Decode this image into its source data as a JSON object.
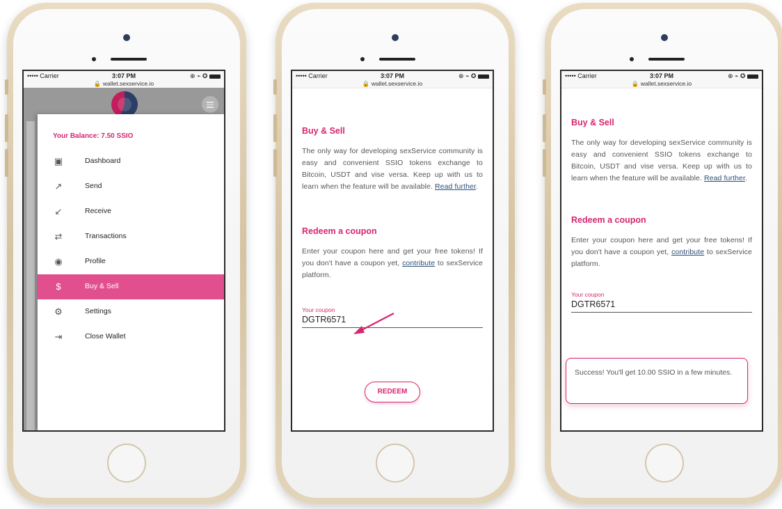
{
  "status": {
    "carrier": "••••• Carrier",
    "time": "3:07 PM",
    "url": "wallet.sexservice.io",
    "right_icons": "⊕ ⌁ ✪"
  },
  "menu": {
    "balance": "Your Balance: 7.50 SSIO",
    "items": [
      {
        "label": "Dashboard",
        "icon": "wallet-icon"
      },
      {
        "label": "Send",
        "icon": "arrow-up-right-icon"
      },
      {
        "label": "Receive",
        "icon": "arrow-down-left-icon"
      },
      {
        "label": "Transactions",
        "icon": "swap-icon"
      },
      {
        "label": "Profile",
        "icon": "user-circle-icon"
      },
      {
        "label": "Buy & Sell",
        "icon": "dollar-icon"
      },
      {
        "label": "Settings",
        "icon": "gear-icon"
      },
      {
        "label": "Close Wallet",
        "icon": "exit-icon"
      }
    ],
    "active": "Buy & Sell"
  },
  "buy_sell": {
    "title": "Buy & Sell",
    "body": "The only way for developing sexService community is easy and convenient SSIO tokens exchange to Bitcoin, USDT and vise versa. Keep up with us to learn when the feature will be available.",
    "read_further": "Read further",
    "period": "."
  },
  "coupon": {
    "title": "Redeem a coupon",
    "body_before": "Enter your coupon here and get your free tokens! If you don't have a coupon yet,",
    "contribute": "contribute",
    "body_after": "to sexService platform.",
    "label": "Your coupon",
    "value": "DGTR6571",
    "button": "REDEEM"
  },
  "toast": {
    "message": "Success! You'll get 10.00 SSIO in a few minutes."
  },
  "colors": {
    "accent": "#d6266f",
    "menu_active": "#e24f8f",
    "phone_gold": "#d5c3a1"
  }
}
